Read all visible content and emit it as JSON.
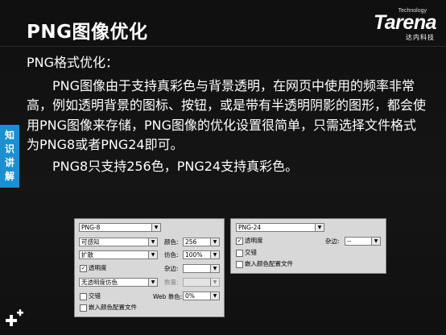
{
  "slide": {
    "title": "PNG图像优化",
    "logo": {
      "tech": "Technology",
      "word": "Tarena",
      "sub": "达内科技"
    },
    "side_tab": [
      "知",
      "识",
      "讲",
      "解"
    ],
    "heading": "PNG格式优化：",
    "paragraph": "PNG图像由于支持真彩色与背景透明，在网页中使用的频率非常高，例如透明背景的图标、按钮，或是带有半透明阴影的图形，都会使用PNG图像来存储，PNG图像的优化设置很简单，只需选择文件格式为PNG8或者PNG24即可。",
    "paragraph2": "PNG8只支持256色，PNG24支持真彩色。"
  },
  "png8_panel": {
    "format": "PNG-8",
    "palette": "可感知",
    "colors_label": "颜色:",
    "colors_value": "256",
    "dither_method": "扩散",
    "dither_label": "仿色:",
    "dither_value": "100%",
    "transparency_label": "透明度",
    "transparency_checked": true,
    "matte_label": "杂边:",
    "matte_value": "",
    "transparency_dither": "无透明度仿色",
    "amount_label": "数量:",
    "amount_value": "",
    "interlaced_label": "交错",
    "web_snap_label": "Web 靠色:",
    "web_snap_value": "0%",
    "embed_profile_label": "嵌入颜色配置文件"
  },
  "png24_panel": {
    "format": "PNG-24",
    "transparency_label": "透明度",
    "transparency_checked": true,
    "matte_label": "杂边:",
    "matte_value": "--",
    "interlaced_label": "交错",
    "embed_profile_label": "嵌入颜色配置文件"
  }
}
